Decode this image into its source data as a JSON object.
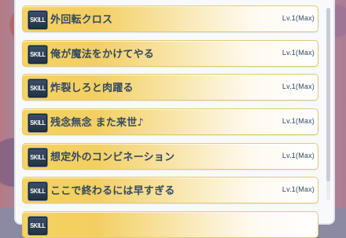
{
  "badge_label": "SKILL",
  "skills": [
    {
      "name": "外回転クロス",
      "level": "Lv.1(Max)"
    },
    {
      "name": "俺が魔法をかけてやる",
      "level": "Lv.1(Max)"
    },
    {
      "name": "炸裂しろと肉躍る",
      "level": "Lv.1(Max)"
    },
    {
      "name": "残念無念 また来世♪",
      "level": "Lv.1(Max)"
    },
    {
      "name": "想定外のコンビネーション",
      "level": "Lv.1(Max)"
    },
    {
      "name": "ここで終わるには早すぎる",
      "level": "Lv.1(Max)"
    },
    {
      "name": "",
      "level": ""
    }
  ],
  "colors": {
    "row_gold": "#f3cf63",
    "row_text": "#334961",
    "badge_bg": "#223244"
  },
  "scroll": {
    "position_fraction": 0.0,
    "visible_fraction": 0.9
  }
}
